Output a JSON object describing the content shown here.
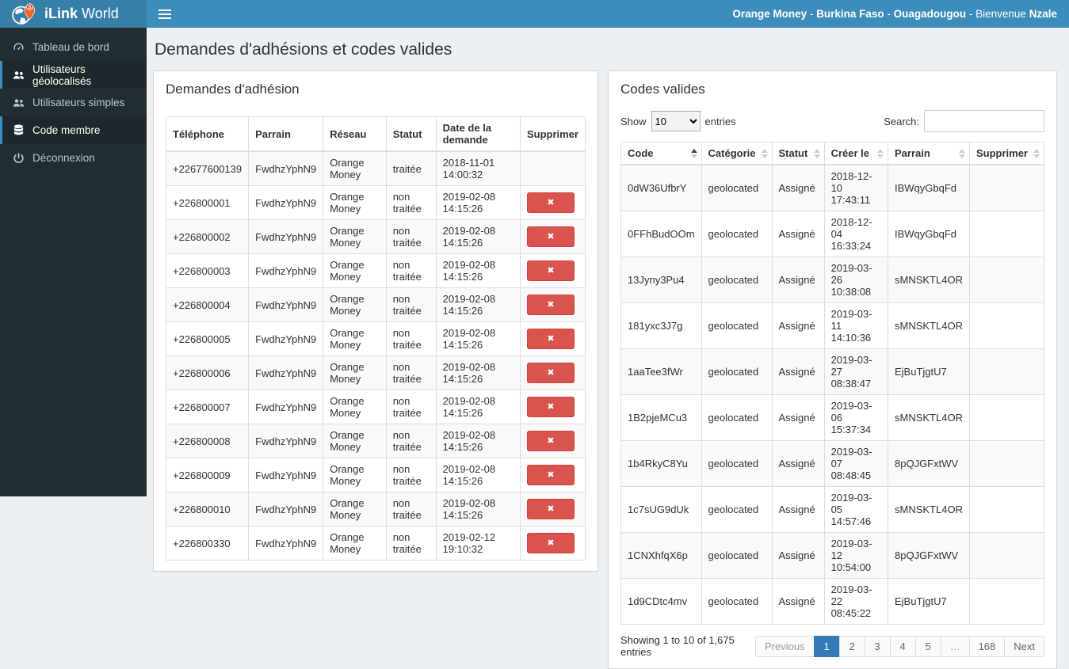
{
  "header": {
    "brand_bold": "iLink",
    "brand_light": "World",
    "user_info": {
      "org": "Orange Money",
      "sep": " - ",
      "country": "Burkina Faso",
      "city": "Ouagadougou",
      "welcome": "Bienvenue",
      "user": "Nzale"
    }
  },
  "sidebar": {
    "items": [
      {
        "label": "Tableau de bord",
        "icon": "dashboard-icon",
        "active": false
      },
      {
        "label": "Utilisateurs géolocalisés",
        "icon": "users-icon",
        "active": true
      },
      {
        "label": "Utilisateurs simples",
        "icon": "users-icon",
        "active": false
      },
      {
        "label": "Code membre",
        "icon": "database-icon",
        "active": true
      },
      {
        "label": "Déconnexion",
        "icon": "power-icon",
        "active": false
      }
    ]
  },
  "page": {
    "title": "Demandes d'adhésions et codes valides"
  },
  "icons": {
    "delete_x": "✖"
  },
  "colors": {
    "navbar": "#3c8dbc",
    "brand_bg": "#367fa9",
    "sidebar_bg": "#222d32",
    "danger": "#d9534f",
    "pagination_active": "#337ab7",
    "page_bg": "#ecf0f5",
    "pin_orange": "#f26522"
  },
  "demandes": {
    "panel_title": "Demandes d'adhésion",
    "columns": [
      "Téléphone",
      "Parrain",
      "Réseau",
      "Statut",
      "Date de la demande",
      "Supprimer"
    ],
    "rows": [
      {
        "telephone": "+22677600139",
        "parrain": "FwdhzYphN9",
        "reseau": "Orange Money",
        "statut": "traitée",
        "date": "2018-11-01 14:00:32"
      },
      {
        "telephone": "+226800001",
        "parrain": "FwdhzYphN9",
        "reseau": "Orange Money",
        "statut": "non traitée",
        "date": "2019-02-08 14:15:26"
      },
      {
        "telephone": "+226800002",
        "parrain": "FwdhzYphN9",
        "reseau": "Orange Money",
        "statut": "non traitée",
        "date": "2019-02-08 14:15:26"
      },
      {
        "telephone": "+226800003",
        "parrain": "FwdhzYphN9",
        "reseau": "Orange Money",
        "statut": "non traitée",
        "date": "2019-02-08 14:15:26"
      },
      {
        "telephone": "+226800004",
        "parrain": "FwdhzYphN9",
        "reseau": "Orange Money",
        "statut": "non traitée",
        "date": "2019-02-08 14:15:26"
      },
      {
        "telephone": "+226800005",
        "parrain": "FwdhzYphN9",
        "reseau": "Orange Money",
        "statut": "non traitée",
        "date": "2019-02-08 14:15:26"
      },
      {
        "telephone": "+226800006",
        "parrain": "FwdhzYphN9",
        "reseau": "Orange Money",
        "statut": "non traitée",
        "date": "2019-02-08 14:15:26"
      },
      {
        "telephone": "+226800007",
        "parrain": "FwdhzYphN9",
        "reseau": "Orange Money",
        "statut": "non traitée",
        "date": "2019-02-08 14:15:26"
      },
      {
        "telephone": "+226800008",
        "parrain": "FwdhzYphN9",
        "reseau": "Orange Money",
        "statut": "non traitée",
        "date": "2019-02-08 14:15:26"
      },
      {
        "telephone": "+226800009",
        "parrain": "FwdhzYphN9",
        "reseau": "Orange Money",
        "statut": "non traitée",
        "date": "2019-02-08 14:15:26"
      },
      {
        "telephone": "+226800010",
        "parrain": "FwdhzYphN9",
        "reseau": "Orange Money",
        "statut": "non traitée",
        "date": "2019-02-08 14:15:26"
      },
      {
        "telephone": "+226800330",
        "parrain": "FwdhzYphN9",
        "reseau": "Orange Money",
        "statut": "non traitée",
        "date": "2019-02-12 19:10:32"
      }
    ]
  },
  "codes": {
    "panel_title": "Codes valides",
    "show_label": "Show",
    "page_length": "10",
    "entries_label": "entries",
    "search_label": "Search:",
    "search_value": "",
    "columns": [
      "Code",
      "Catégorie",
      "Statut",
      "Créer le",
      "Parrain",
      "Supprimer"
    ],
    "sorted_column": "Code",
    "rows": [
      {
        "code": "0dW36UfbrY",
        "categorie": "geolocated",
        "statut": "Assigné",
        "cree_le": "2018-12-10 17:43:11",
        "parrain": "IBWqyGbqFd"
      },
      {
        "code": "0FFhBudOOm",
        "categorie": "geolocated",
        "statut": "Assigné",
        "cree_le": "2018-12-04 16:33:24",
        "parrain": "IBWqyGbqFd"
      },
      {
        "code": "13Jyny3Pu4",
        "categorie": "geolocated",
        "statut": "Assigné",
        "cree_le": "2019-03-26 10:38:08",
        "parrain": "sMNSKTL4OR"
      },
      {
        "code": "181yxc3J7g",
        "categorie": "geolocated",
        "statut": "Assigné",
        "cree_le": "2019-03-11 14:10:36",
        "parrain": "sMNSKTL4OR"
      },
      {
        "code": "1aaTee3fWr",
        "categorie": "geolocated",
        "statut": "Assigné",
        "cree_le": "2019-03-27 08:38:47",
        "parrain": "EjBuTjgtU7"
      },
      {
        "code": "1B2pjeMCu3",
        "categorie": "geolocated",
        "statut": "Assigné",
        "cree_le": "2019-03-06 15:37:34",
        "parrain": "sMNSKTL4OR"
      },
      {
        "code": "1b4RkyC8Yu",
        "categorie": "geolocated",
        "statut": "Assigné",
        "cree_le": "2019-03-07 08:48:45",
        "parrain": "8pQJGFxtWV"
      },
      {
        "code": "1c7sUG9dUk",
        "categorie": "geolocated",
        "statut": "Assigné",
        "cree_le": "2019-03-05 14:57:46",
        "parrain": "sMNSKTL4OR"
      },
      {
        "code": "1CNXhfqX6p",
        "categorie": "geolocated",
        "statut": "Assigné",
        "cree_le": "2019-03-12 10:54:00",
        "parrain": "8pQJGFxtWV"
      },
      {
        "code": "1d9CDtc4mv",
        "categorie": "geolocated",
        "statut": "Assigné",
        "cree_le": "2019-03-22 08:45:22",
        "parrain": "EjBuTjgtU7"
      }
    ],
    "info": "Showing 1 to 10 of 1,675 entries",
    "pagination": {
      "previous": "Previous",
      "pages": [
        "1",
        "2",
        "3",
        "4",
        "5",
        "…",
        "168"
      ],
      "next": "Next",
      "active_page": "1"
    }
  }
}
